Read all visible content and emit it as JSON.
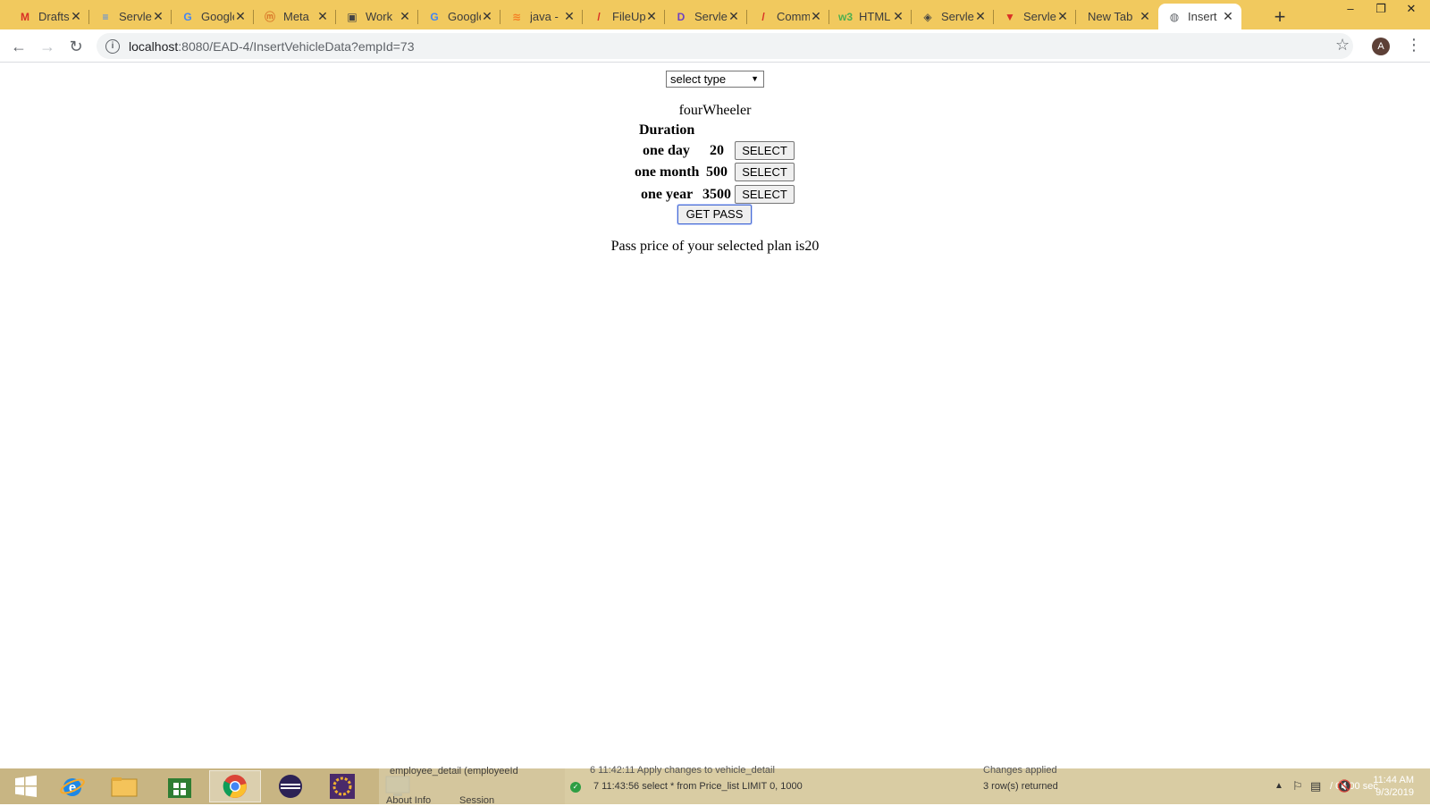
{
  "browser": {
    "tabs": [
      {
        "title": "Drafts",
        "icon": "gmail-icon",
        "icon_glyph": "M",
        "icon_color": "#d93025"
      },
      {
        "title": "Servlet",
        "icon": "docs-icon",
        "icon_glyph": "≡",
        "icon_color": "#4285f4"
      },
      {
        "title": "Google",
        "icon": "google-icon",
        "icon_glyph": "G",
        "icon_color": "#4285f4"
      },
      {
        "title": "Meta",
        "icon": "meta-icon",
        "icon_glyph": "ⓜ",
        "icon_color": "#d97a2b"
      },
      {
        "title": "Work",
        "icon": "book-icon",
        "icon_glyph": "▣",
        "icon_color": "#444444"
      },
      {
        "title": "Google",
        "icon": "google-icon",
        "icon_glyph": "G",
        "icon_color": "#4285f4"
      },
      {
        "title": "java -",
        "icon": "stackoverflow-icon",
        "icon_glyph": "≋",
        "icon_color": "#f48024"
      },
      {
        "title": "FileUp",
        "icon": "pencil-icon",
        "icon_glyph": "/",
        "icon_color": "#d93025"
      },
      {
        "title": "Servlet",
        "icon": "dz-icon",
        "icon_glyph": "D",
        "icon_color": "#6f42c1"
      },
      {
        "title": "Comm",
        "icon": "pencil-icon",
        "icon_glyph": "/",
        "icon_color": "#d93025"
      },
      {
        "title": "HTML",
        "icon": "w3-icon",
        "icon_glyph": "w3",
        "icon_color": "#4caf50"
      },
      {
        "title": "Servlet",
        "icon": "diamond-icon",
        "icon_glyph": "◈",
        "icon_color": "#444444"
      },
      {
        "title": "Servlet",
        "icon": "tutorial-icon",
        "icon_glyph": "▼",
        "icon_color": "#d93025"
      },
      {
        "title": "New Tab",
        "icon": "",
        "icon_glyph": "",
        "icon_color": "#444444"
      },
      {
        "title": "Insert",
        "icon": "globe-icon",
        "icon_glyph": "◍",
        "icon_color": "#5f6368"
      }
    ],
    "close_glyph": "✕",
    "new_tab_glyph": "+",
    "url_host": "localhost",
    "url_rest": ":8080/EAD-4/InsertVehicleData?empId=73",
    "profile_initial": "A"
  },
  "page": {
    "select": {
      "value": "select type"
    },
    "vehicle_type": "fourWheeler",
    "duration_header": "Duration",
    "plans": [
      {
        "label": "one day",
        "price": "20",
        "button": "SELECT"
      },
      {
        "label": "one month",
        "price": "500",
        "button": "SELECT"
      },
      {
        "label": "one year",
        "price": "3500",
        "button": "SELECT"
      }
    ],
    "get_pass_button": "GET PASS",
    "result_text": "Pass price of your selected plan is20"
  },
  "taskbar": {
    "peek_line1": "employee_detail (employeeId",
    "peek_line2": "About Info",
    "peek_line3": "Session",
    "log_line_top": "6  11:42:11  Apply changes to vehicle_detail",
    "log_status_top": "Changes applied",
    "log_line": "7   11:43:56   select * from Price_list LIMIT 0, 1000",
    "log_status": "3 row(s) returned",
    "duration_text": "/ 0.000 sec",
    "time": "11:44 AM",
    "date": "9/3/2019"
  }
}
